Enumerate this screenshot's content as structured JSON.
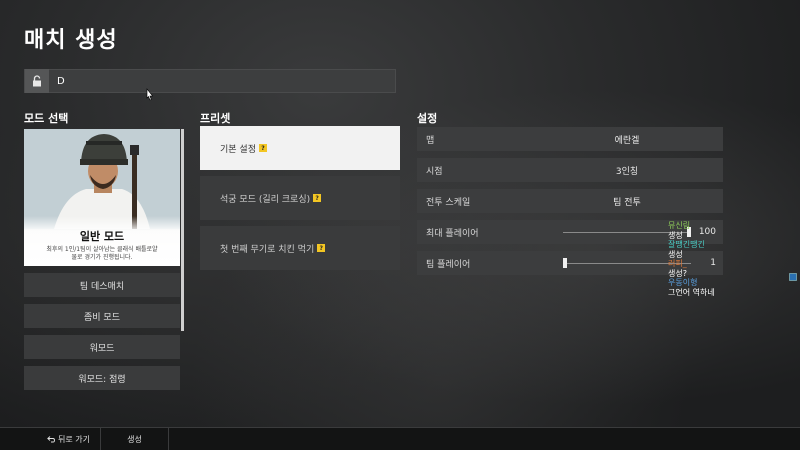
{
  "page": {
    "title": "매치 생성"
  },
  "password": {
    "value": "D",
    "icon": "lock-open-icon"
  },
  "mode": {
    "section_label": "모드 선택",
    "card": {
      "name": "일반 모드",
      "desc_line1": "최후의 1인/1팀이 살아남는 클래식 배틀로얄",
      "desc_line2": "물로 경기가 진행됩니다."
    },
    "items": [
      {
        "label": "팀 데스매치"
      },
      {
        "label": "좀비 모드"
      },
      {
        "label": "워모드"
      },
      {
        "label": "워모드: 점령"
      }
    ]
  },
  "presets": {
    "section_label": "프리셋",
    "items": [
      {
        "label": "기본 설정",
        "help": "?",
        "active": true
      },
      {
        "label": "석궁 모드 (길리 크로싱)",
        "help": "?",
        "active": false
      },
      {
        "label": "첫 번째 무기로 치킨 먹기",
        "help": "?",
        "active": false
      }
    ]
  },
  "settings": {
    "section_label": "설정",
    "rows": [
      {
        "label": "맵",
        "value": "에란겔"
      },
      {
        "label": "시점",
        "value": "3인칭"
      },
      {
        "label": "전투 스케일",
        "value": "팀 전투"
      }
    ],
    "sliders": [
      {
        "label": "최대 플레이어",
        "value": "100",
        "fraction": 1.0
      },
      {
        "label": "팀 플레이어",
        "value": "1",
        "fraction": 0.0
      }
    ]
  },
  "chat": [
    {
      "text": "뮤신림",
      "color": "#8fcf5a"
    },
    {
      "text": "생성",
      "color": "#ffffff"
    },
    {
      "text": "잘땡긴땡긴",
      "color": "#4ad0c8"
    },
    {
      "text": "생성",
      "color": "#ffffff"
    },
    {
      "text": "러피_",
      "color": "#e07a3a"
    },
    {
      "text": "생성?",
      "color": "#ffffff"
    },
    {
      "text": "우동이형",
      "color": "#5aa0e0"
    },
    {
      "text": "그언어 역하네",
      "color": "#ffffff"
    }
  ],
  "bottom": {
    "back_label": "뒤로 가기",
    "back_icon": "back-arrow-icon",
    "create_label": "생성"
  }
}
